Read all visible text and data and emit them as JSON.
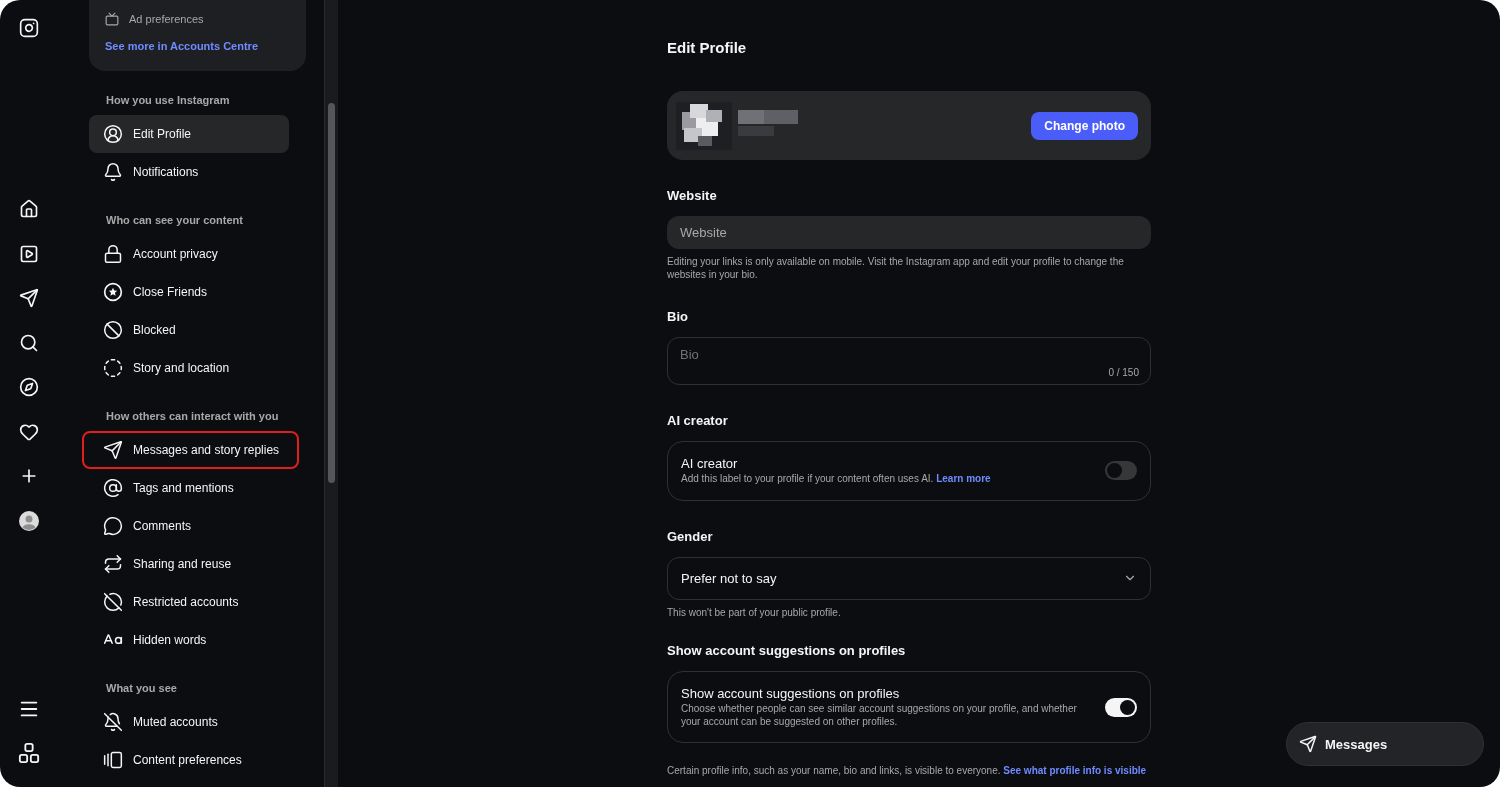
{
  "settings_sidebar": {
    "accounts_card": {
      "items": [
        {
          "label": "Ad preferences"
        }
      ],
      "link": "See more in Accounts Centre"
    },
    "sections": [
      {
        "heading": "How you use Instagram",
        "items": [
          {
            "label": "Edit Profile",
            "selected": true,
            "highlighted": false
          },
          {
            "label": "Notifications",
            "selected": false,
            "highlighted": false
          }
        ]
      },
      {
        "heading": "Who can see your content",
        "items": [
          {
            "label": "Account privacy",
            "selected": false,
            "highlighted": false
          },
          {
            "label": "Close Friends",
            "selected": false,
            "highlighted": false
          },
          {
            "label": "Blocked",
            "selected": false,
            "highlighted": false
          },
          {
            "label": "Story and location",
            "selected": false,
            "highlighted": false
          }
        ]
      },
      {
        "heading": "How others can interact with you",
        "items": [
          {
            "label": "Messages and story replies",
            "selected": false,
            "highlighted": true
          },
          {
            "label": "Tags and mentions",
            "selected": false,
            "highlighted": false
          },
          {
            "label": "Comments",
            "selected": false,
            "highlighted": false
          },
          {
            "label": "Sharing and reuse",
            "selected": false,
            "highlighted": false
          },
          {
            "label": "Restricted accounts",
            "selected": false,
            "highlighted": false
          },
          {
            "label": "Hidden words",
            "selected": false,
            "highlighted": false
          }
        ]
      },
      {
        "heading": "What you see",
        "items": [
          {
            "label": "Muted accounts",
            "selected": false,
            "highlighted": false
          },
          {
            "label": "Content preferences",
            "selected": false,
            "highlighted": false
          }
        ]
      }
    ]
  },
  "main": {
    "title": "Edit Profile",
    "profile_card": {
      "button": "Change photo"
    },
    "website": {
      "label": "Website",
      "placeholder": "Website",
      "help": "Editing your links is only available on mobile. Visit the Instagram app and edit your profile to change the websites in your bio."
    },
    "bio": {
      "label": "Bio",
      "placeholder": "Bio",
      "counter": "0 / 150"
    },
    "ai_creator": {
      "heading": "AI creator",
      "title": "AI creator",
      "description": "Add this label to your profile if your content often uses AI.",
      "link": "Learn more",
      "on": false
    },
    "gender": {
      "label": "Gender",
      "value": "Prefer not to say",
      "help": "This won't be part of your public profile."
    },
    "suggestions": {
      "heading": "Show account suggestions on profiles",
      "title": "Show account suggestions on profiles",
      "description": "Choose whether people can see similar account suggestions on your profile, and whether your account can be suggested on other profiles.",
      "on": true
    },
    "footer": {
      "text": "Certain profile info, such as your name, bio and links, is visible to everyone.",
      "link": "See what profile info is visible"
    }
  },
  "messages_button": {
    "label": "Messages"
  }
}
